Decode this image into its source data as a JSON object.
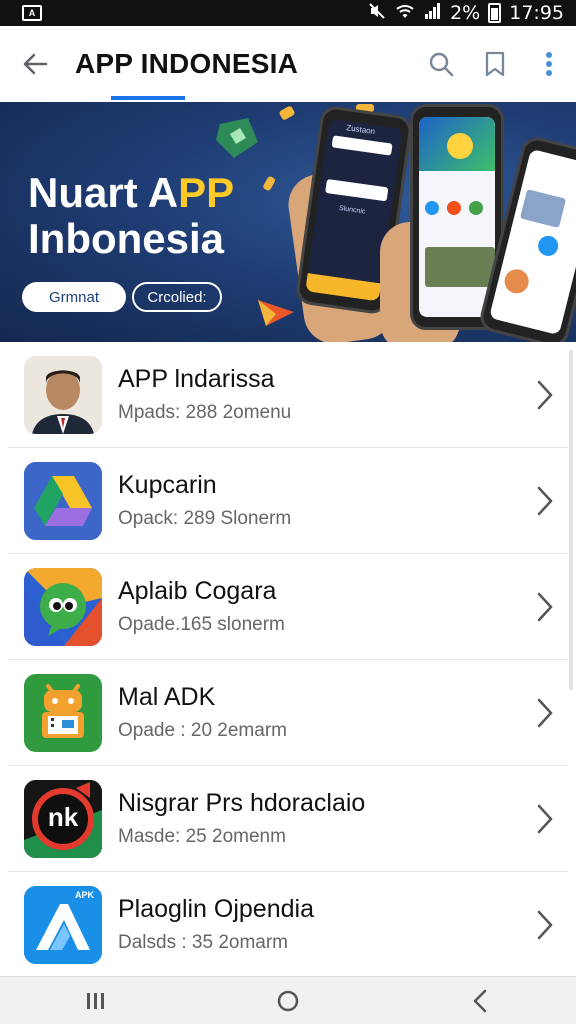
{
  "status_bar": {
    "app_icon": "A",
    "battery_text": "2%",
    "time": "17:95",
    "icons": [
      "mute-icon",
      "wifi-icon",
      "signal-icon",
      "battery-icon"
    ]
  },
  "app_bar": {
    "title": "APP INDONESIA",
    "icons": [
      "back-arrow-icon",
      "search-icon",
      "bookmark-icon",
      "more-vert-icon"
    ],
    "accent": "#1a73e8"
  },
  "banner": {
    "title_line1_white": "Nuart A",
    "title_line1_accent": "PP",
    "title_line2": "Inbonesia",
    "button_primary": "Grmnat",
    "button_secondary": "Crcolied:",
    "phone_text": "Zustaon",
    "phone_caption": "Sluncnic"
  },
  "apps": [
    {
      "title": "APP lndarissa",
      "subtitle": "Mpads: 288 2omenu",
      "icon": "person-photo-icon"
    },
    {
      "title": "Kupcarin",
      "subtitle": "Opack: 289 Slonerm",
      "icon": "drive-triangle-icon"
    },
    {
      "title": "Aplaib Cogara",
      "subtitle": "Opade.165 slonerm",
      "icon": "chat-bubble-eyes-icon"
    },
    {
      "title": "Mal ADK",
      "subtitle": "Opade : 20 2emarm",
      "icon": "android-box-icon"
    },
    {
      "title": "Nisgrar Prs hdoraclaio",
      "subtitle": "Masde: 25 2omenm",
      "icon": "speed-dial-icon",
      "icon_text": "nk"
    },
    {
      "title": "Plaoglin Ojpendia",
      "subtitle": "Dalsds : 35 2omarm",
      "icon": "apk-logo-icon",
      "icon_text": "APK"
    }
  ],
  "nav_bar": {
    "icons": [
      "recents-icon",
      "home-icon",
      "back-icon"
    ]
  }
}
